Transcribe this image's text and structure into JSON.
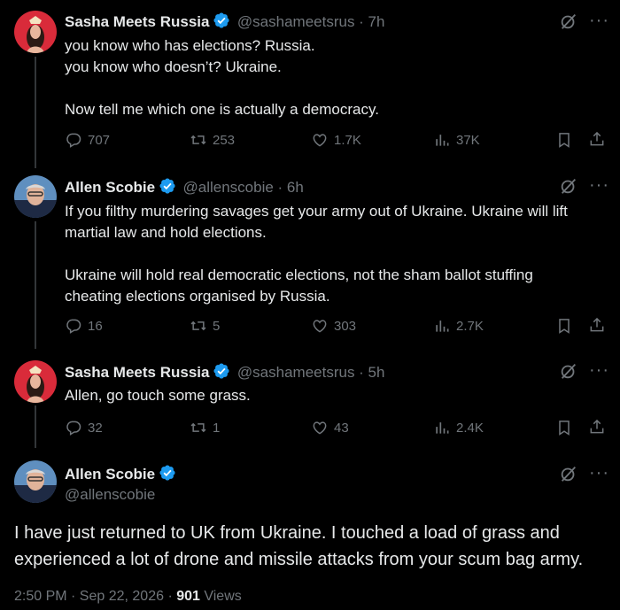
{
  "colors": {
    "background": "#000000",
    "text": "#e7e9ea",
    "muted": "#71767b",
    "verified": "#1d9bf0",
    "line": "#333639"
  },
  "tweets": [
    {
      "name": "Sasha Meets Russia",
      "handle": "@sashameetsrus · 7h",
      "lines": [
        "you know who has elections? Russia.",
        "you know who doesn’t? Ukraine.",
        "",
        "Now tell me which one is actually a democracy."
      ],
      "replies": "707",
      "reposts": "253",
      "likes": "1.7K",
      "views": "37K"
    },
    {
      "name": "Allen Scobie",
      "handle": "@allenscobie · 6h",
      "lines": [
        "If you filthy murdering savages get your army out of Ukraine. Ukraine will lift",
        "martial law and hold elections.",
        "",
        "Ukraine will hold real democratic elections, not the sham ballot stuffing",
        "cheating elections organised by Russia."
      ],
      "replies": "16",
      "reposts": "5",
      "likes": "303",
      "views": "2.7K"
    },
    {
      "name": "Sasha Meets Russia",
      "handle": "@sashameetsrus · 5h",
      "lines": [
        "Allen, go touch some grass."
      ],
      "replies": "32",
      "reposts": "1",
      "likes": "43",
      "views": "2.4K"
    }
  ],
  "main_tweet": {
    "name": "Allen Scobie",
    "handle": "@allenscobie",
    "lines": [
      "I have just returned to UK from Ukraine. I touched a load of grass and",
      "experienced a lot of drone and missile attacks from your scum bag army."
    ],
    "timestamp": "2:50 PM · Sep 22, 2026 · ",
    "views_count": "901",
    "views_label": " Views"
  },
  "icons": {
    "grok": "grok-icon",
    "more": "more-icon",
    "reply": "reply-icon",
    "repost": "repost-icon",
    "like": "like-icon",
    "views": "views-icon",
    "bookmark": "bookmark-icon",
    "share": "share-icon",
    "verified": "verified-badge-icon"
  },
  "more_glyph": "···"
}
